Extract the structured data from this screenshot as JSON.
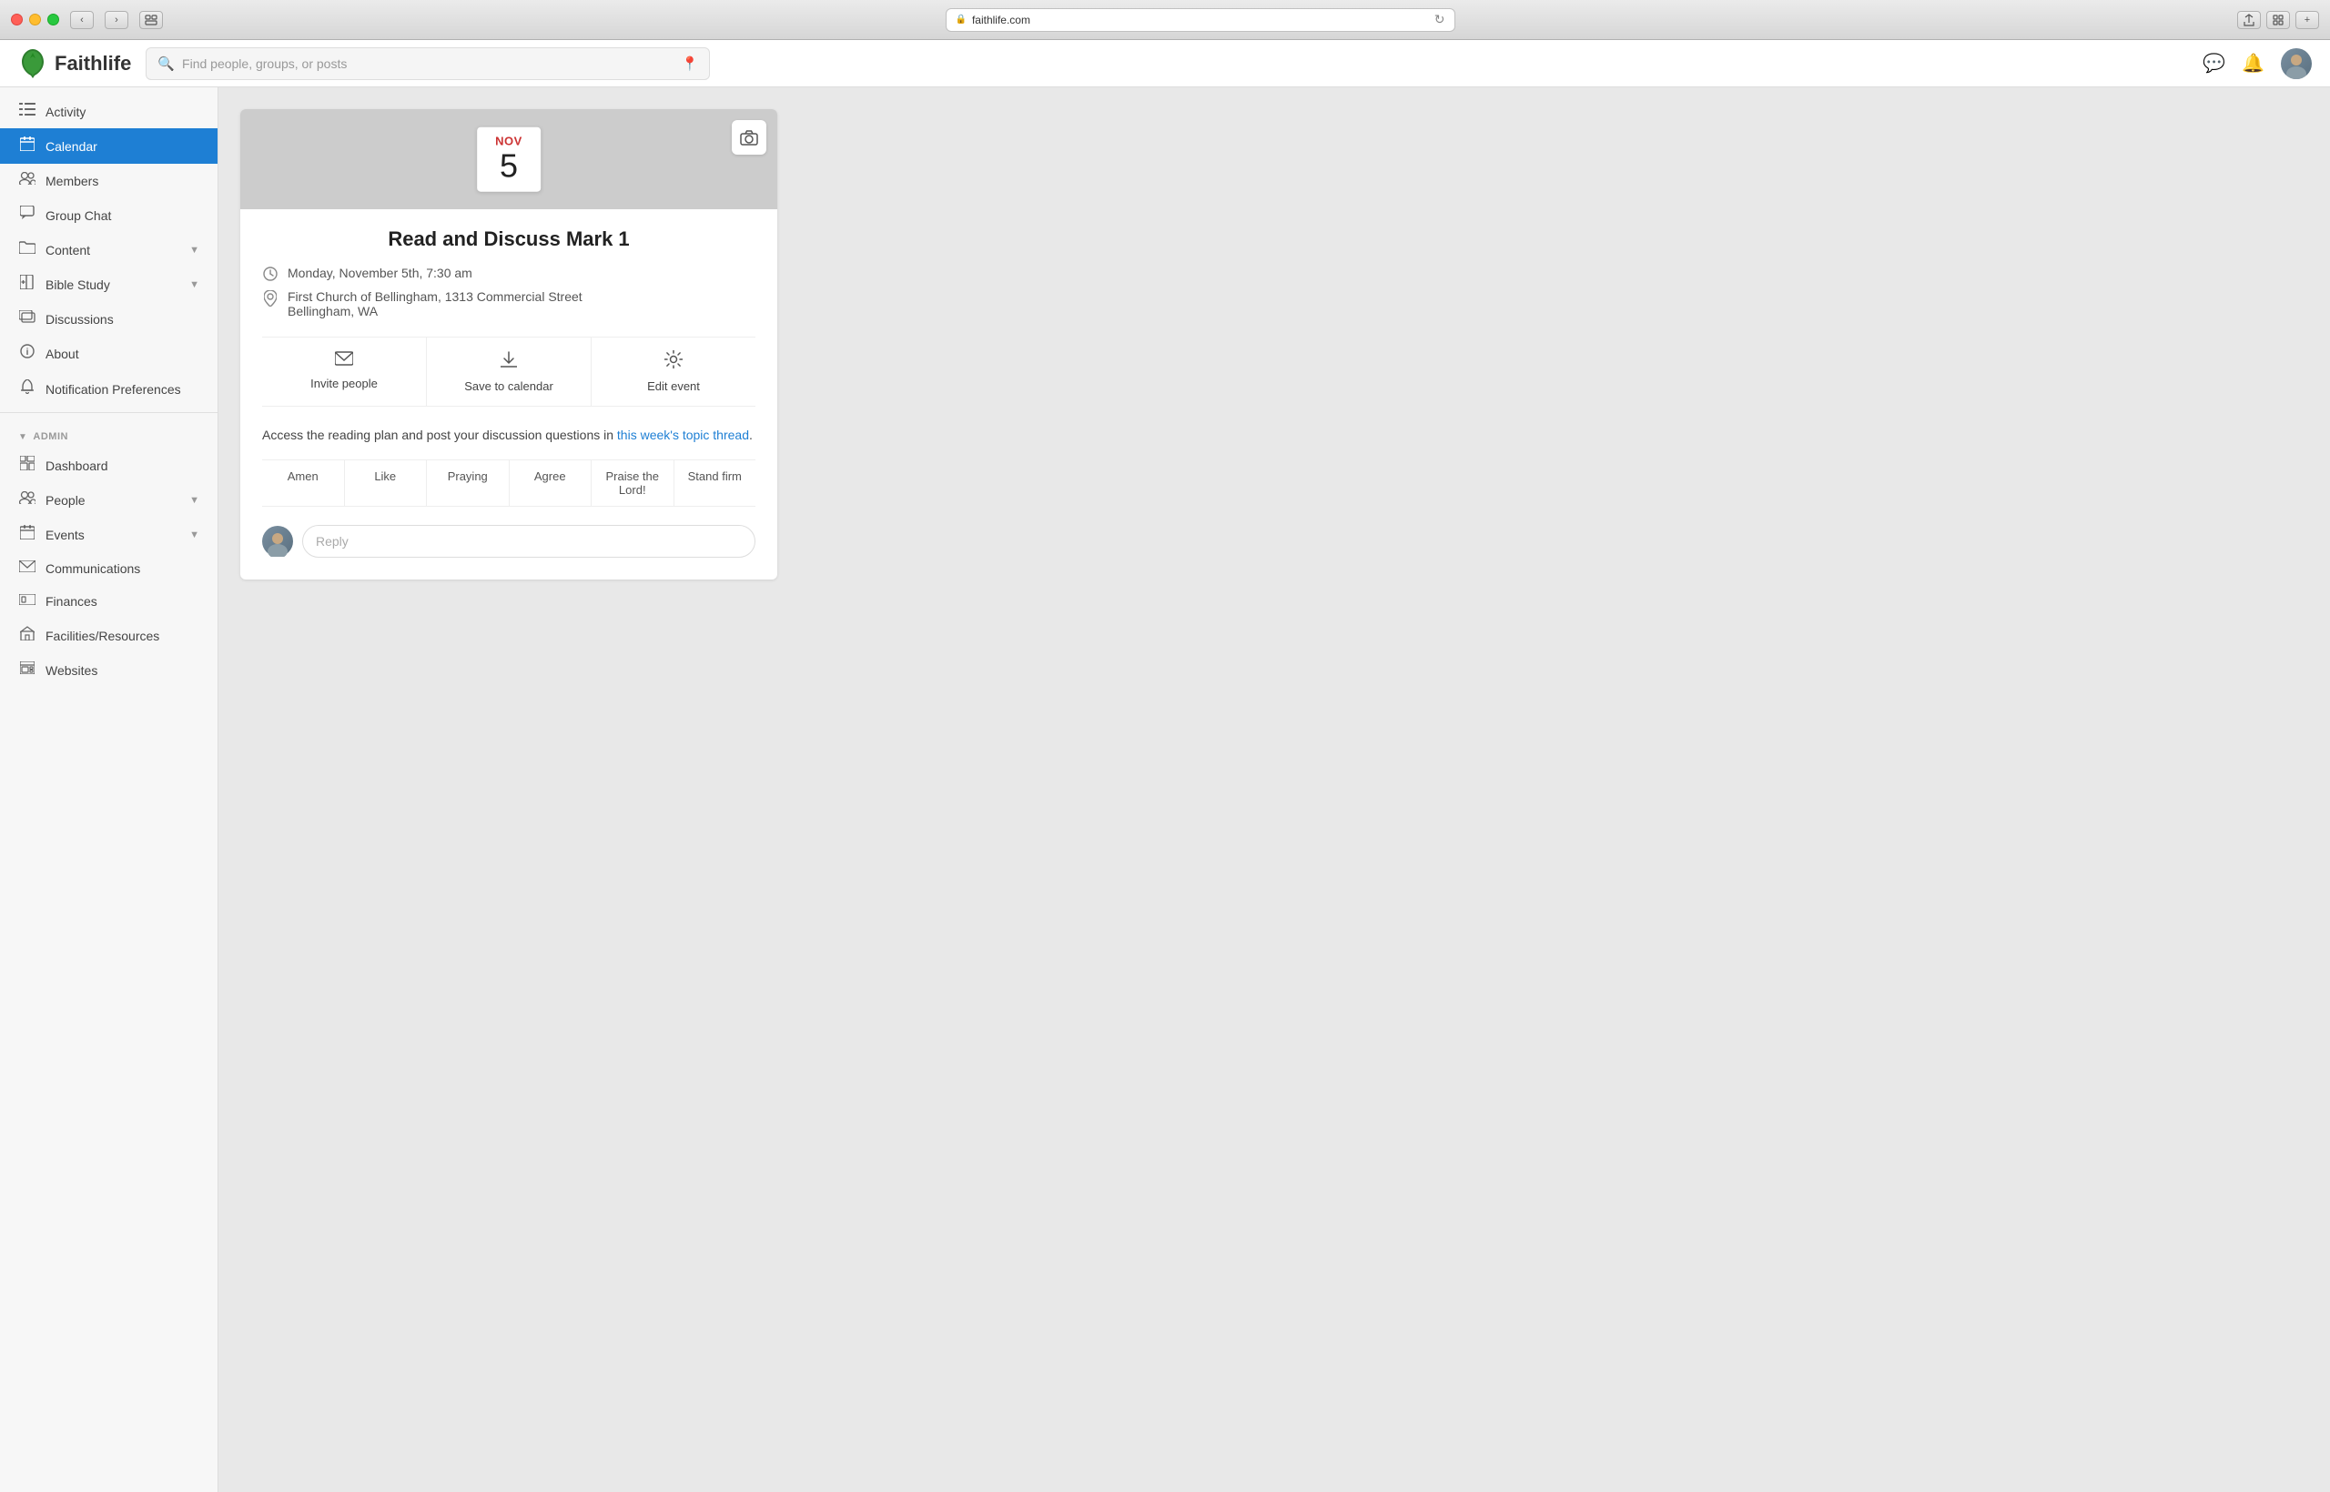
{
  "titlebar": {
    "url": "faithlife.com",
    "reload_title": "Reload page"
  },
  "header": {
    "logo_text": "Faithlife",
    "search_placeholder": "Find people, groups, or posts"
  },
  "sidebar": {
    "main_items": [
      {
        "id": "activity",
        "label": "Activity",
        "icon": "list"
      },
      {
        "id": "calendar",
        "label": "Calendar",
        "icon": "calendar",
        "active": true
      },
      {
        "id": "members",
        "label": "Members",
        "icon": "people"
      },
      {
        "id": "group-chat",
        "label": "Group Chat",
        "icon": "chat"
      },
      {
        "id": "content",
        "label": "Content",
        "icon": "folder",
        "has_chevron": true
      },
      {
        "id": "bible-study",
        "label": "Bible Study",
        "icon": "bible",
        "has_chevron": true
      },
      {
        "id": "discussions",
        "label": "Discussions",
        "icon": "discussions"
      },
      {
        "id": "about",
        "label": "About",
        "icon": "info"
      },
      {
        "id": "notification-preferences",
        "label": "Notification Preferences",
        "icon": "bell"
      }
    ],
    "admin_section": "ADMIN",
    "admin_items": [
      {
        "id": "dashboard",
        "label": "Dashboard",
        "icon": "dashboard"
      },
      {
        "id": "people",
        "label": "People",
        "icon": "people",
        "has_chevron": true
      },
      {
        "id": "events",
        "label": "Events",
        "icon": "calendar",
        "has_chevron": true
      },
      {
        "id": "communications",
        "label": "Communications",
        "icon": "email"
      },
      {
        "id": "finances",
        "label": "Finances",
        "icon": "finances"
      },
      {
        "id": "facilities",
        "label": "Facilities/Resources",
        "icon": "facilities"
      },
      {
        "id": "websites",
        "label": "Websites",
        "icon": "websites"
      }
    ]
  },
  "event": {
    "date_month": "NOV",
    "date_day": "5",
    "title": "Read and Discuss Mark 1",
    "time": "Monday, November 5th, 7:30 am",
    "location_line1": "First Church of Bellingham, 1313 Commercial Street",
    "location_line2": "Bellingham, WA",
    "actions": [
      {
        "id": "invite",
        "icon": "✉",
        "label": "Invite people"
      },
      {
        "id": "save",
        "icon": "⬇",
        "label": "Save to calendar"
      },
      {
        "id": "edit",
        "icon": "⚙",
        "label": "Edit event"
      }
    ],
    "description_prefix": "Access the reading plan and post your discussion questions in ",
    "description_link": "this week's topic thread",
    "description_suffix": ".",
    "reactions": [
      {
        "id": "amen",
        "label": "Amen"
      },
      {
        "id": "like",
        "label": "Like"
      },
      {
        "id": "praying",
        "label": "Praying"
      },
      {
        "id": "agree",
        "label": "Agree"
      },
      {
        "id": "praise",
        "label": "Praise the Lord!"
      },
      {
        "id": "stand-firm",
        "label": "Stand firm"
      }
    ],
    "reply_placeholder": "Reply"
  }
}
